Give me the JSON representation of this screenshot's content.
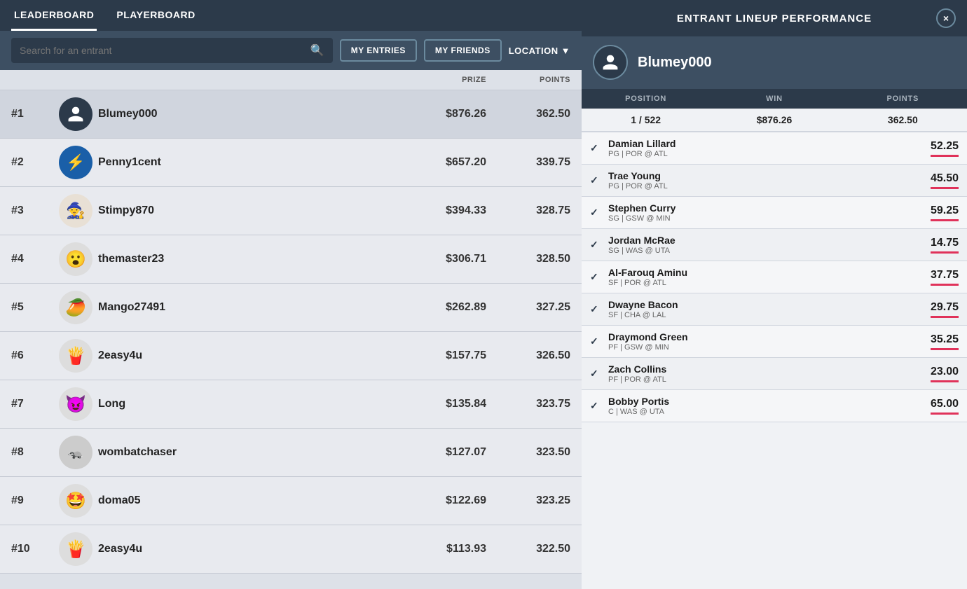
{
  "nav": {
    "tabs": [
      {
        "id": "leaderboard",
        "label": "LEADERBOARD",
        "active": true
      },
      {
        "id": "playerboard",
        "label": "PLAYERBOARD",
        "active": false
      }
    ]
  },
  "search": {
    "placeholder": "Search for an entrant"
  },
  "filters": {
    "my_entries_label": "MY ENTRIES",
    "my_friends_label": "MY FRIENDS",
    "location_label": "LOCATION"
  },
  "columns": {
    "prize_label": "PRIZE",
    "points_label": "POINTS"
  },
  "leaderboard": {
    "rows": [
      {
        "rank": "#1",
        "name": "Blumey000",
        "prize": "$876.26",
        "points": "362.50",
        "avatar_type": "person",
        "selected": true
      },
      {
        "rank": "#2",
        "name": "Penny1cent",
        "prize": "$657.20",
        "points": "339.75",
        "avatar_type": "blue_logo",
        "selected": false
      },
      {
        "rank": "#3",
        "name": "Stimpy870",
        "prize": "$394.33",
        "points": "328.75",
        "avatar_type": "stimpy",
        "selected": false
      },
      {
        "rank": "#4",
        "name": "themaster23",
        "prize": "$306.71",
        "points": "328.50",
        "avatar_type": "surprised",
        "selected": false
      },
      {
        "rank": "#5",
        "name": "Mango27491",
        "prize": "$262.89",
        "points": "327.25",
        "avatar_type": "mango",
        "selected": false
      },
      {
        "rank": "#6",
        "name": "2easy4u",
        "prize": "$157.75",
        "points": "326.50",
        "avatar_type": "fries",
        "selected": false
      },
      {
        "rank": "#7",
        "name": "Long",
        "prize": "$135.84",
        "points": "323.75",
        "avatar_type": "devil",
        "selected": false
      },
      {
        "rank": "#8",
        "name": "wombatchaser",
        "prize": "$127.07",
        "points": "323.50",
        "avatar_type": "wombat",
        "selected": false
      },
      {
        "rank": "#9",
        "name": "doma05",
        "prize": "$122.69",
        "points": "323.25",
        "avatar_type": "star_eyes",
        "selected": false
      },
      {
        "rank": "#10",
        "name": "2easy4u",
        "prize": "$113.93",
        "points": "322.50",
        "avatar_type": "fries",
        "selected": false
      }
    ]
  },
  "right_panel": {
    "title": "ENTRANT LINEUP PERFORMANCE",
    "close_label": "×",
    "player_name": "Blumey000",
    "perf_headers": [
      "POSITION",
      "WIN",
      "POINTS"
    ],
    "perf_stats": [
      "1 / 522",
      "$876.26",
      "362.50"
    ],
    "players": [
      {
        "name": "Damian Lillard",
        "pos": "PG | POR @ ATL",
        "score": "52.25"
      },
      {
        "name": "Trae Young",
        "pos": "PG | POR @ ATL",
        "score": "45.50"
      },
      {
        "name": "Stephen Curry",
        "pos": "SG | GSW @ MIN",
        "score": "59.25"
      },
      {
        "name": "Jordan McRae",
        "pos": "SG | WAS @ UTA",
        "score": "14.75"
      },
      {
        "name": "Al-Farouq Aminu",
        "pos": "SF | POR @ ATL",
        "score": "37.75"
      },
      {
        "name": "Dwayne Bacon",
        "pos": "SF | CHA @ LAL",
        "score": "29.75"
      },
      {
        "name": "Draymond Green",
        "pos": "PF | GSW @ MIN",
        "score": "35.25"
      },
      {
        "name": "Zach Collins",
        "pos": "PF | POR @ ATL",
        "score": "23.00"
      },
      {
        "name": "Bobby Portis",
        "pos": "C | WAS @ UTA",
        "score": "65.00"
      }
    ]
  }
}
